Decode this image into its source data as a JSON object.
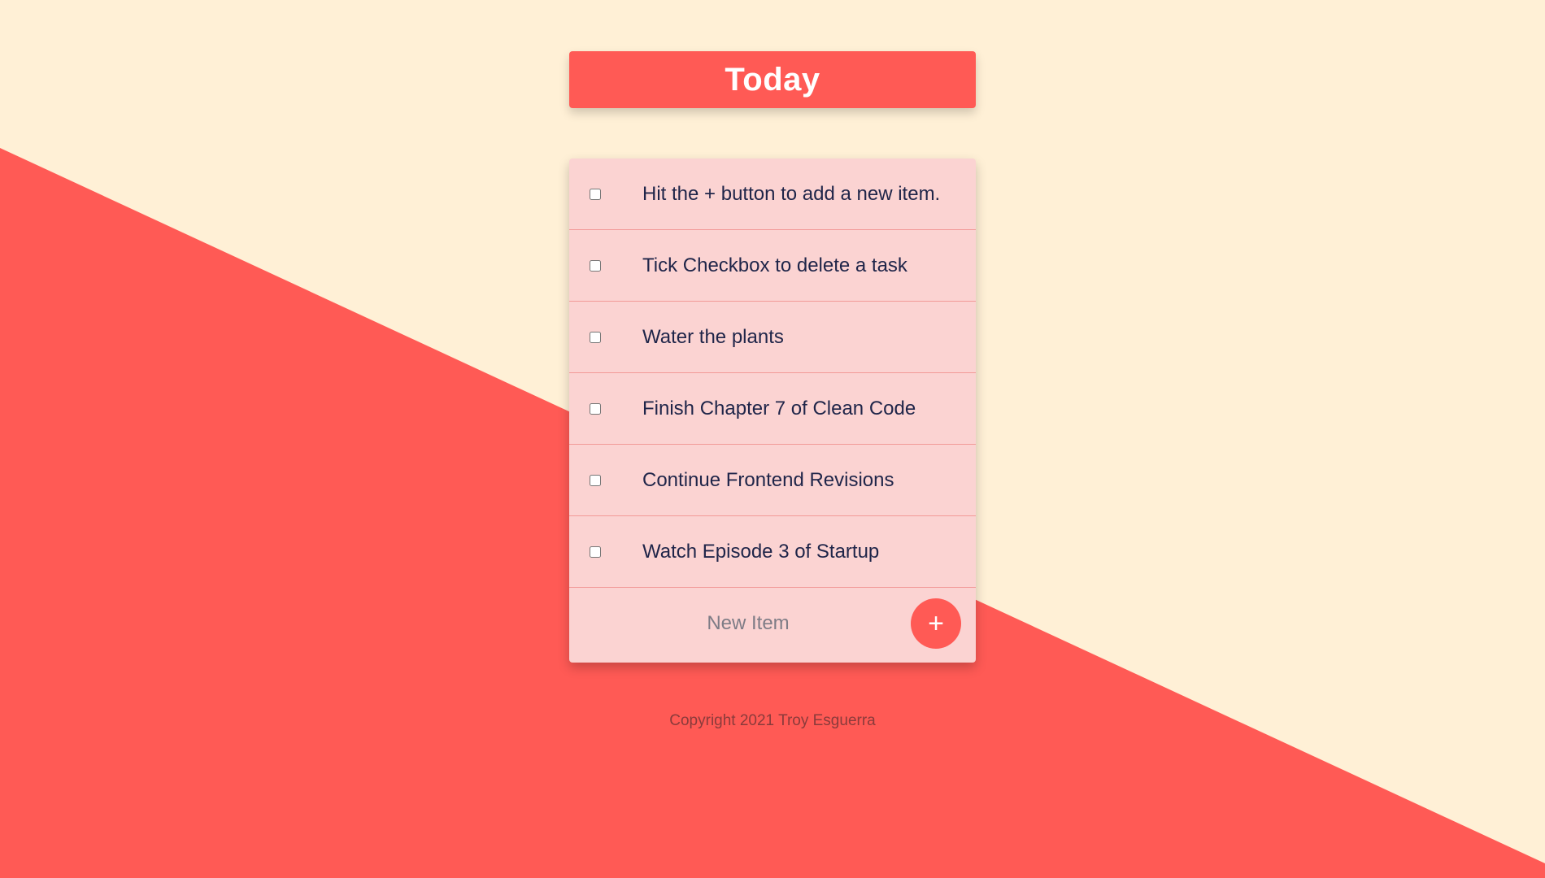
{
  "theme": {
    "background_light": "#fff0d6",
    "background_accent": "#ff5a55",
    "card_color": "#fbd3d2",
    "text_color": "#1f2549"
  },
  "header": {
    "title": "Today"
  },
  "items": [
    {
      "label": "Hit the + button to add a new item.",
      "checked": false
    },
    {
      "label": "Tick Checkbox to delete a task",
      "checked": false
    },
    {
      "label": "Water the plants",
      "checked": false
    },
    {
      "label": "Finish Chapter 7 of Clean Code",
      "checked": false
    },
    {
      "label": "Continue Frontend Revisions",
      "checked": false
    },
    {
      "label": "Watch Episode 3 of Startup",
      "checked": false
    }
  ],
  "new_item": {
    "placeholder": "New Item",
    "value": "",
    "add_button_label": "+"
  },
  "footer": {
    "text": "Copyright 2021 Troy Esguerra"
  }
}
